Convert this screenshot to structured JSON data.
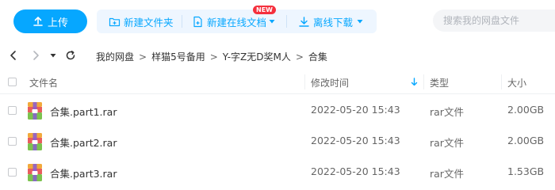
{
  "toolbar": {
    "upload_label": "上传",
    "new_folder_label": "新建文件夹",
    "new_doc_label": "新建在线文档",
    "new_badge": "NEW",
    "offline_label": "离线下载",
    "search_placeholder": "搜索我的网盘文件"
  },
  "breadcrumb": [
    "我的网盘",
    "样猫5号备用",
    "Y-字Z无D奖M人",
    "合集"
  ],
  "table": {
    "columns": {
      "name": "文件名",
      "modified": "修改时间",
      "type": "类型",
      "size": "大小"
    },
    "rows": [
      {
        "name": "合集.part1.rar",
        "modified": "2022-05-20 15:43",
        "type": "rar文件",
        "size": "2.00GB"
      },
      {
        "name": "合集.part2.rar",
        "modified": "2022-05-20 15:43",
        "type": "rar文件",
        "size": "2.00GB"
      },
      {
        "name": "合集.part3.rar",
        "modified": "2022-05-20 15:43",
        "type": "rar文件",
        "size": "1.53GB"
      }
    ]
  },
  "colors": {
    "accent": "#06a7ff",
    "badge": "#f5303d",
    "toolbar_bg": "#eef6ff"
  },
  "icons": [
    "upload-icon",
    "new-folder-icon",
    "new-doc-icon",
    "dropdown-icon",
    "download-icon",
    "back-icon",
    "forward-icon",
    "refresh-icon",
    "sort-arrow-icon",
    "rar-file-icon"
  ]
}
